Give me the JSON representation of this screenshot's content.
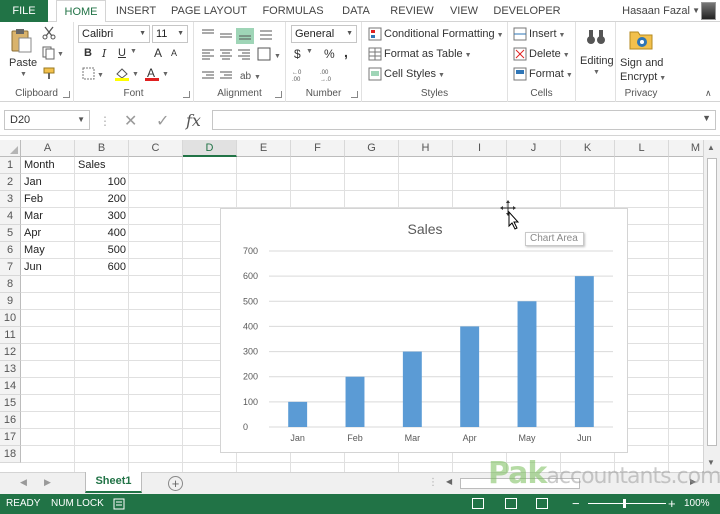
{
  "ribbon_tabs": [
    "FILE",
    "HOME",
    "INSERT",
    "PAGE LAYOUT",
    "FORMULAS",
    "DATA",
    "REVIEW",
    "VIEW",
    "DEVELOPER"
  ],
  "user_name": "Hasaan Fazal",
  "clipboard": {
    "paste_label": "Paste",
    "group_label": "Clipboard"
  },
  "font": {
    "name": "Calibri",
    "size": "11",
    "bold": "B",
    "italic": "I",
    "underline": "U",
    "grow": "A",
    "shrink": "A",
    "group_label": "Font"
  },
  "alignment": {
    "group_label": "Alignment"
  },
  "number": {
    "format": "General",
    "currency": "$",
    "percent": "%",
    "comma": ",",
    "group_label": "Number"
  },
  "styles": {
    "conditional": "Conditional Formatting",
    "format_table": "Format as Table",
    "cell_styles": "Cell Styles",
    "group_label": "Styles"
  },
  "cells": {
    "insert": "Insert",
    "delete": "Delete",
    "format": "Format",
    "group_label": "Cells"
  },
  "editing": {
    "label": "Editing"
  },
  "privacy": {
    "line1": "Sign and",
    "line2": "Encrypt",
    "group_label": "Privacy"
  },
  "formula_bar": {
    "name_box": "D20",
    "fx": "fx",
    "cancel": "✕",
    "enter": "✓"
  },
  "columns": [
    "A",
    "B",
    "C",
    "D",
    "E",
    "F",
    "G",
    "H",
    "I",
    "J",
    "K",
    "L",
    "M"
  ],
  "selected_column": "D",
  "rows": [
    "1",
    "2",
    "3",
    "4",
    "5",
    "6",
    "7",
    "8",
    "9",
    "10",
    "11",
    "12",
    "13",
    "14",
    "15",
    "16",
    "17",
    "18"
  ],
  "table": {
    "headers": [
      "Month",
      "Sales"
    ],
    "rows": [
      [
        "Jan",
        "100"
      ],
      [
        "Feb",
        "200"
      ],
      [
        "Mar",
        "300"
      ],
      [
        "Apr",
        "400"
      ],
      [
        "May",
        "500"
      ],
      [
        "Jun",
        "600"
      ]
    ]
  },
  "chart_data": {
    "type": "bar",
    "title": "Sales",
    "categories": [
      "Jan",
      "Feb",
      "Mar",
      "Apr",
      "May",
      "Jun"
    ],
    "values": [
      100,
      200,
      300,
      400,
      500,
      600
    ],
    "ylim": [
      0,
      700
    ],
    "yticks": [
      "0",
      "100",
      "200",
      "300",
      "400",
      "500",
      "600",
      "700"
    ],
    "grid": true,
    "bar_color": "#5b9bd5",
    "xlabel": "",
    "ylabel": ""
  },
  "tooltip": "Chart Area",
  "sheet_tab": "Sheet1",
  "watermark": {
    "brand": "Pak",
    "rest": "accountants.com"
  },
  "status": {
    "ready": "READY",
    "numlock": "NUM LOCK",
    "zoom": "100%"
  },
  "colors": {
    "excel_green": "#217346",
    "accent_bar": "#5b9bd5"
  }
}
